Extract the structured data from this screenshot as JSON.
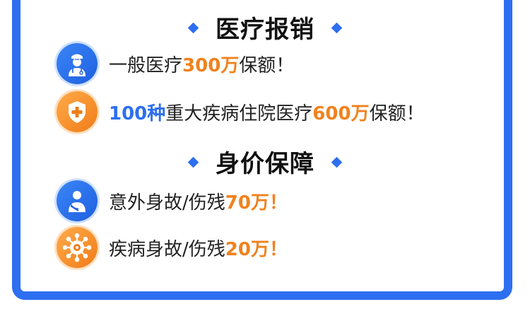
{
  "colors": {
    "accent_blue": "#2d6ff0",
    "accent_orange": "#f0821e",
    "text": "#222222"
  },
  "sections": {
    "medical": {
      "title": "医疗报销",
      "item1": {
        "icon": "doctor-icon",
        "prefix": "一般医疗",
        "amount": "300万",
        "suffix": "保额！"
      },
      "item2": {
        "icon": "shield-cross-icon",
        "count": "100种",
        "middle": "重大疾病住院医疗",
        "amount": "600万",
        "suffix": "保额！"
      }
    },
    "life": {
      "title": "身价保障",
      "item1": {
        "icon": "injured-person-icon",
        "prefix": "意外身故/伤残",
        "amount": "70万！"
      },
      "item2": {
        "icon": "virus-icon",
        "prefix": "疾病身故/伤残",
        "amount": "20万！"
      }
    }
  }
}
